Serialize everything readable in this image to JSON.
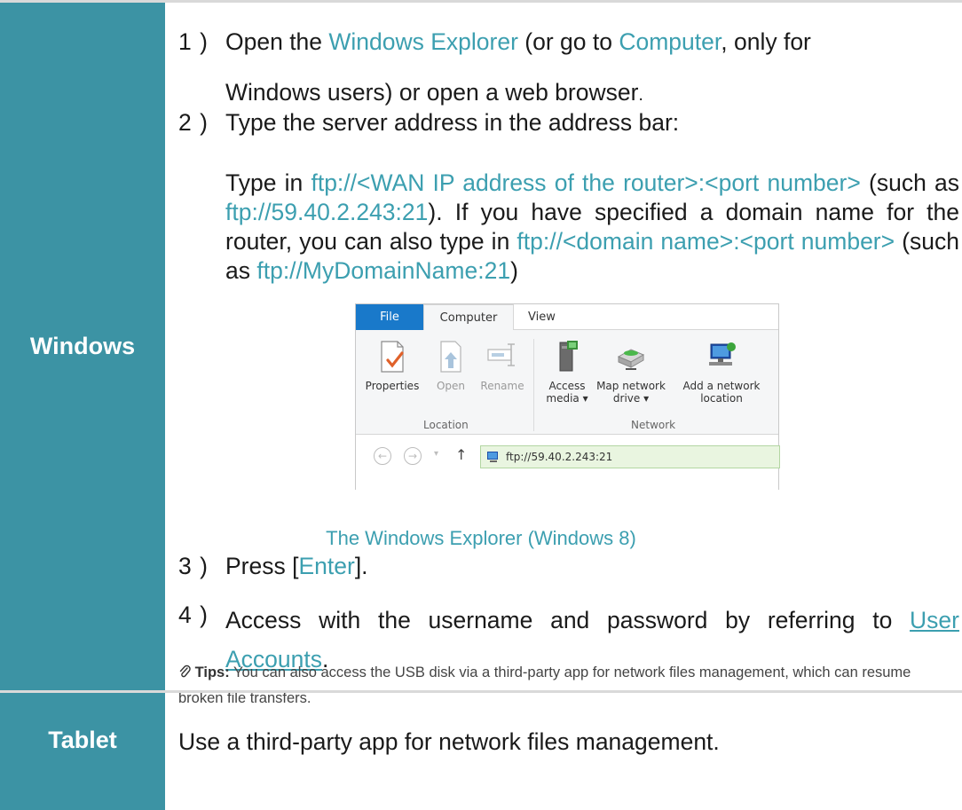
{
  "rows": {
    "windows_label": "Windows",
    "tablet_label": "Tablet",
    "tablet_text": "Use a third-party app for network files management."
  },
  "steps": {
    "s1_num": "1 )",
    "s1_a": "Open the ",
    "s1_hl1": "Windows Explorer",
    "s1_b": " (or go to ",
    "s1_hl2": "Computer",
    "s1_c": ", only for",
    "s1_line2": "Windows users) or open a web browser",
    "s1_dot": ".",
    "s2_num": "2 )",
    "s2_text": "Type the server address in the address bar:",
    "s2_p_a": "Type in ",
    "s2_p_hl1": "ftp://<WAN IP address of the router>:<port number>",
    "s2_p_b": " (such as ",
    "s2_p_hl2": "ftp://59.40.2.243:21",
    "s2_p_c": "). If you have specified a domain name for the router, you can also type in ",
    "s2_p_hl3": "ftp://<domain name>:<port number>",
    "s2_p_d": " (such as ",
    "s2_p_hl4": "ftp://MyDomainName:21",
    "s2_p_e": ")",
    "s3_num": "3 )",
    "s3_a": "Press [",
    "s3_hl": "Enter",
    "s3_b": "].",
    "s4_num": "4 )",
    "s4_a": "Access with the username and password by referring to ",
    "s4_link": "User Accounts",
    "s4_b": "."
  },
  "caption": "The Windows Explorer (Windows 8)",
  "tips": {
    "icon": "paperclip-icon",
    "label": "Tips:",
    "text": " You can also access the USB disk via a third-party app for network files management, which can resume broken file transfers."
  },
  "explorer": {
    "tabs": [
      "File",
      "Computer",
      "View"
    ],
    "buttons": {
      "properties": "Properties",
      "open": "Open",
      "rename": "Rename",
      "access_media_1": "Access",
      "access_media_2": "media ▾",
      "map_drive_1": "Map network",
      "map_drive_2": "drive ▾",
      "add_location_1": "Add a network",
      "add_location_2": "location"
    },
    "groups": [
      "Location",
      "Network"
    ],
    "address": "ftp://59.40.2.243:21"
  },
  "colors": {
    "label_bg": "#3c93a4",
    "highlight": "#3c9fb0",
    "file_tab": "#1979ca"
  }
}
